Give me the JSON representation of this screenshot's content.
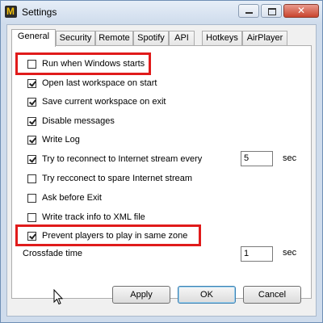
{
  "window": {
    "title": "Settings",
    "close_glyph": "✕"
  },
  "tabs": [
    {
      "label": "General",
      "active": true
    },
    {
      "label": "Security"
    },
    {
      "label": "Remote"
    },
    {
      "label": "Spotify"
    },
    {
      "label": "API"
    },
    {
      "label": "Hotkeys"
    },
    {
      "label": "AirPlayer"
    }
  ],
  "options": [
    {
      "label": "Run when Windows starts",
      "checked": false
    },
    {
      "label": "Open last workspace on start",
      "checked": true
    },
    {
      "label": "Save current workspace on exit",
      "checked": true
    },
    {
      "label": "Disable messages",
      "checked": true
    },
    {
      "label": "Write Log",
      "checked": true
    },
    {
      "label": "Try to reconnect to Internet stream every",
      "checked": true
    },
    {
      "label": "Try recconect to spare Internet stream",
      "checked": false
    },
    {
      "label": "Ask before Exit",
      "checked": false
    },
    {
      "label": "Write track info to XML file",
      "checked": false
    },
    {
      "label": "Prevent players to play in same zone",
      "checked": true
    }
  ],
  "reconnect_interval": {
    "value": "5",
    "unit": "sec"
  },
  "crossfade": {
    "label": "Crossfade time",
    "value": "1",
    "unit": "sec"
  },
  "buttons": {
    "apply": "Apply",
    "ok": "OK",
    "cancel": "Cancel"
  },
  "colors": {
    "highlight": "#e01b1b"
  }
}
